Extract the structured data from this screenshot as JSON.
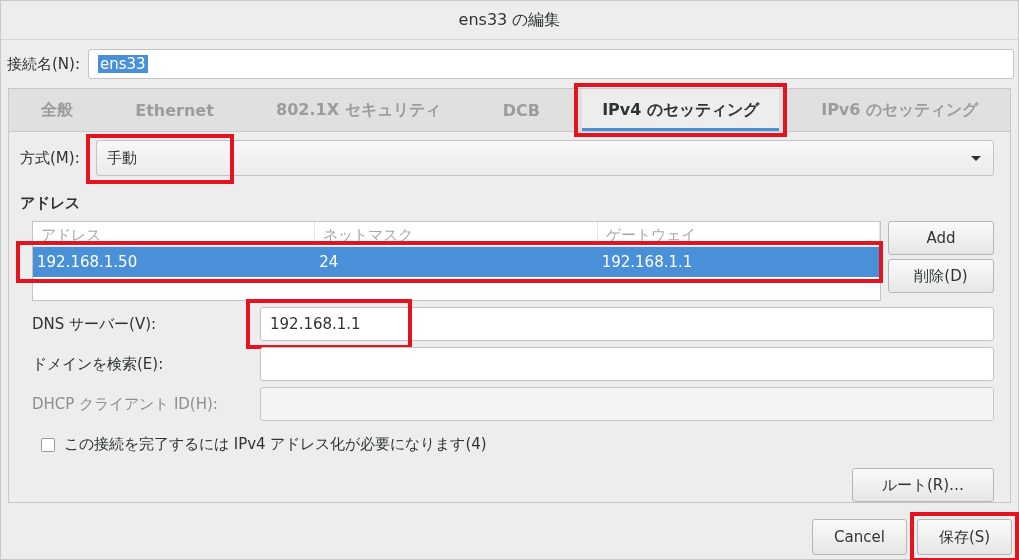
{
  "window": {
    "title": "ens33 の編集"
  },
  "connection_name": {
    "label": "接続名(N):",
    "value": "ens33"
  },
  "tabs": [
    {
      "label": "全般",
      "selected": false,
      "highlighted": false
    },
    {
      "label": "Ethernet",
      "selected": false,
      "highlighted": false
    },
    {
      "label": "802.1X セキュリティ",
      "selected": false,
      "highlighted": false
    },
    {
      "label": "DCB",
      "selected": false,
      "highlighted": false
    },
    {
      "label": "IPv4 のセッティング",
      "selected": true,
      "highlighted": true
    },
    {
      "label": "IPv6 のセッティング",
      "selected": false,
      "highlighted": false
    }
  ],
  "method": {
    "label": "方式(M):",
    "value": "手動",
    "highlighted": true
  },
  "addresses": {
    "heading": "アドレス",
    "columns": [
      "アドレス",
      "ネットマスク",
      "ゲートウェイ"
    ],
    "rows": [
      {
        "cells": [
          "192.168.1.50",
          "24",
          "192.168.1.1"
        ],
        "selected": true,
        "highlighted": true
      }
    ],
    "buttons": [
      {
        "label": "Add"
      },
      {
        "label": "削除(D)"
      }
    ]
  },
  "fields": [
    {
      "label": "DNS サーバー(V):",
      "value": "192.168.1.1",
      "disabled": false,
      "highlighted": true
    },
    {
      "label": "ドメインを検索(E):",
      "disabled": false,
      "highlighted": false
    },
    {
      "label": "DHCP クライアント ID(H):",
      "disabled": true,
      "highlighted": false
    }
  ],
  "require_ipv4": {
    "label": "この接続を完了するには IPv4 アドレス化が必要になります(4)",
    "checked": false
  },
  "routes_button": {
    "label": "ルート(R)…"
  },
  "footer_buttons": [
    {
      "label": "Cancel",
      "highlighted": false
    },
    {
      "label": "保存(S)",
      "highlighted": true
    }
  ]
}
